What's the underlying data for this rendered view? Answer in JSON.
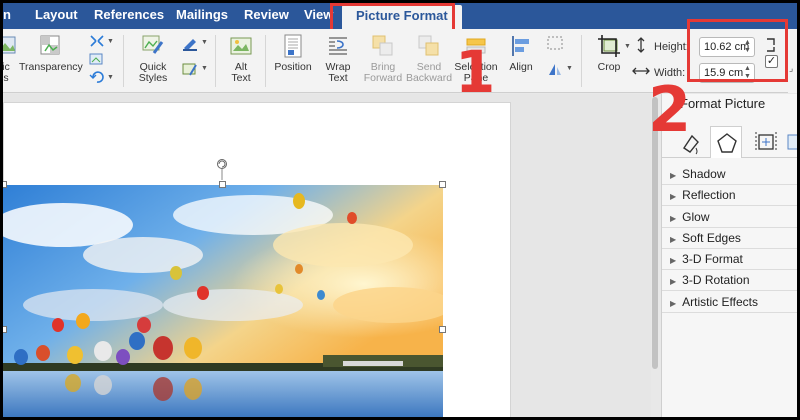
{
  "ribbon": {
    "tabs": [
      {
        "label": "n"
      },
      {
        "label": "Layout"
      },
      {
        "label": "References"
      },
      {
        "label": "Mailings"
      },
      {
        "label": "Review"
      },
      {
        "label": "View"
      },
      {
        "label": "Picture Format"
      }
    ],
    "active_tab": "Picture Format"
  },
  "toolbar": {
    "artistic_label_1": "ic",
    "artistic_label_2": "s",
    "transparency": "Transparency",
    "quick_styles_1": "Quick",
    "quick_styles_2": "Styles",
    "alt_text_1": "Alt",
    "alt_text_2": "Text",
    "position": "Position",
    "wrap_text_1": "Wrap",
    "wrap_text_2": "Text",
    "bring_forward_1": "Bring",
    "bring_forward_2": "Forward",
    "send_backward_1": "Send",
    "send_backward_2": "Backward",
    "selection_pane_1": "Selection",
    "selection_pane_2": "Pane",
    "align": "Align",
    "crop": "Crop",
    "height_label": "Height:",
    "height_value": "10.62 cm",
    "width_label": "Width:",
    "width_value": "15.9 cm",
    "lock_mark": "✓"
  },
  "pane": {
    "title": "Format Picture",
    "sections": [
      "Shadow",
      "Reflection",
      "Glow",
      "Soft Edges",
      "3-D Format",
      "3-D Rotation",
      "Artistic Effects"
    ]
  },
  "annotations": {
    "step1": "1",
    "step2": "2"
  },
  "colors": {
    "ribbon_blue": "#2b579a",
    "highlight_red": "#e53935"
  }
}
